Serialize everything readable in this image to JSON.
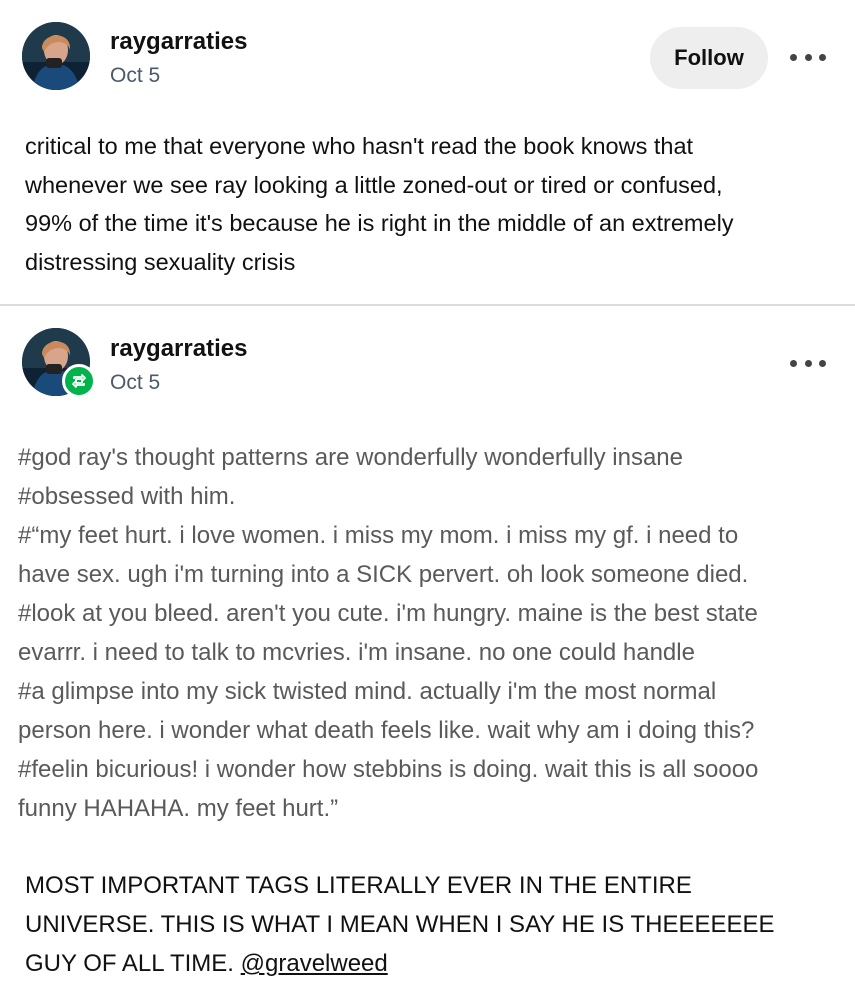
{
  "post1": {
    "username": "raygarraties",
    "date": "Oct 5",
    "follow_label": "Follow",
    "body_lines": [
      "critical to me that everyone who hasn't read the book knows that",
      "whenever we see ray looking a little zoned-out or tired or confused,",
      "99% of the time it's because he is right in the middle of an extremely",
      "distressing sexuality crisis"
    ]
  },
  "post2": {
    "username": "raygarraties",
    "date": "Oct 5",
    "reblog_icon": "reblog-icon",
    "tag_lines": [
      "#god ray's thought patterns are wonderfully wonderfully insane",
      "#obsessed with him.",
      "#“my feet hurt. i love women. i miss my mom. i miss my gf. i need to",
      "have sex. ugh i'm turning into a SICK pervert. oh look someone died.",
      "#look at you bleed. aren't you cute. i'm hungry. maine is the best state",
      "evarrr. i need to talk to mcvries. i'm insane. no one could handle",
      "#a glimpse into my sick twisted mind. actually i'm the most normal",
      "person here. i wonder what death feels like. wait why am i doing this?",
      "#feelin bicurious! i wonder how stebbins is doing. wait this is all soooo",
      "funny HAHAHA. my feet hurt.”"
    ],
    "final_text": "MOST IMPORTANT TAGS LITERALLY EVER IN THE ENTIRE UNIVERSE. THIS IS WHAT I MEAN WHEN I SAY HE IS THEEEEEEE GUY OF ALL TIME.",
    "mention": "@gravelweed"
  },
  "colors": {
    "follow_bg": "#eeeeee",
    "date": "#4a5a6a",
    "tags": "#5a5a5a",
    "reblog_badge": "#00b34a",
    "divider": "#dcdcdc"
  }
}
